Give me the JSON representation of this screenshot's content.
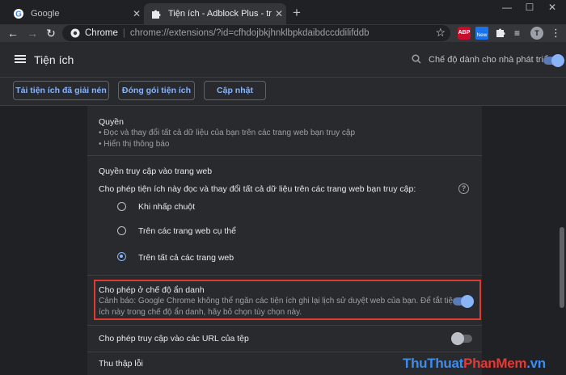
{
  "tabs": [
    {
      "title": "Google",
      "icon": "google-icon",
      "active": false
    },
    {
      "title": "Tiện ích - Adblock Plus - trình ch",
      "icon": "puzzle-icon",
      "active": true
    }
  ],
  "omnibox": {
    "site": "Chrome",
    "separator": "|",
    "url": "chrome://extensions/?id=cfhdojbkjhnklbpkdaibdccddilifddb"
  },
  "toolbar_extensions": {
    "abp": "ABP",
    "news": "New",
    "avatar": "T"
  },
  "header": {
    "title": "Tiện ích",
    "dev_mode_label": "Chế độ dành cho nhà phát triển",
    "dev_mode_on": true
  },
  "actions": {
    "load_unpacked": "Tải tiện ích đã giải nén",
    "pack": "Đóng gói tiện ích",
    "update": "Cập nhật"
  },
  "permissions": {
    "title": "Quyền",
    "items": [
      "• Đọc và thay đổi tất cả dữ liệu của bạn trên các trang web bạn truy cập",
      "• Hiển thị thông báo"
    ]
  },
  "site_access": {
    "title": "Quyền truy cập vào trang web",
    "question": "Cho phép tiện ích này đọc và thay đổi tất cả dữ liệu trên các trang web bạn truy cập:",
    "options": [
      "Khi nhấp chuột",
      "Trên các trang web cụ thể",
      "Trên tất cả các trang web"
    ],
    "selected_index": 2
  },
  "incognito": {
    "title": "Cho phép ở chế độ ẩn danh",
    "desc1": "Cảnh báo: Google Chrome không thể ngăn các tiện ích ghi lại lịch sử duyệt web của bạn. Để tắt tiện",
    "desc2": "ích này trong chế độ ẩn danh, hãy bỏ chọn tùy chọn này.",
    "enabled": true
  },
  "file_urls": {
    "title": "Cho phép truy cập vào các URL của tệp",
    "enabled": false
  },
  "errors": {
    "title": "Thu thập lỗi"
  },
  "watermark": {
    "part1": "ThuThuat",
    "part2": "PhanMem",
    ".vn": ".vn"
  },
  "colors": {
    "accent": "#8ab4f8",
    "highlight": "#e03a2f",
    "background": "#202124",
    "card": "#292a2d"
  }
}
